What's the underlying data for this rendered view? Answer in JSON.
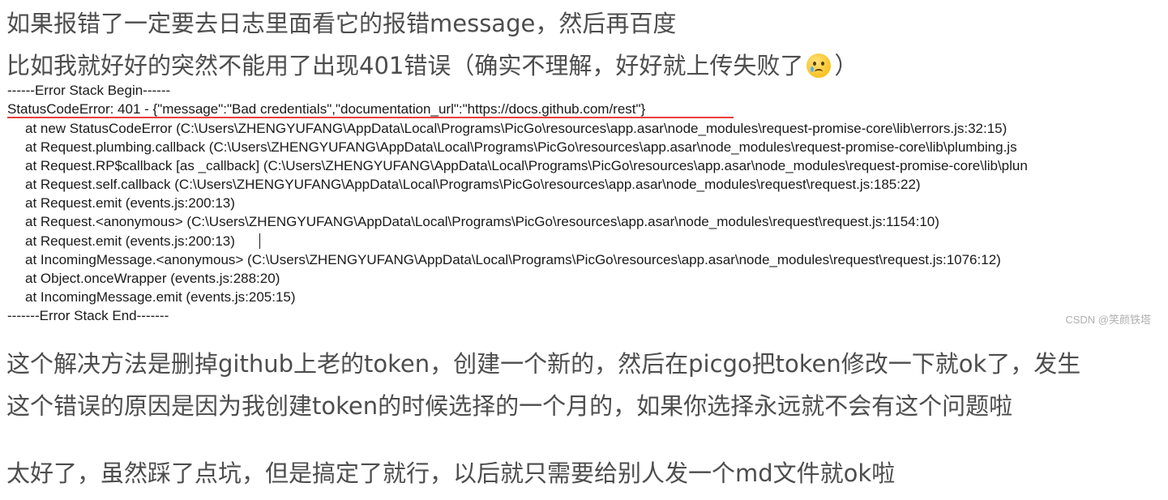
{
  "intro": {
    "line1": "如果报错了一定要去日志里面看它的报错message，然后再百度",
    "line2_text": "比如我就好好的突然不能用了出现401错误（确实不理解，好好就上传失败了",
    "line2_close": "）",
    "emoji_icon": "sad-tear-face-emoji"
  },
  "log": {
    "stack_begin": "------Error Stack Begin------",
    "error_line": "StatusCodeError: 401 - {\"message\":\"Bad credentials\",\"documentation_url\":\"https://docs.github.com/rest\"}",
    "frames": [
      "at new StatusCodeError (C:\\Users\\ZHENGYUFANG\\AppData\\Local\\Programs\\PicGo\\resources\\app.asar\\node_modules\\request-promise-core\\lib\\errors.js:32:15)",
      "at Request.plumbing.callback (C:\\Users\\ZHENGYUFANG\\AppData\\Local\\Programs\\PicGo\\resources\\app.asar\\node_modules\\request-promise-core\\lib\\plumbing.js",
      "at Request.RP$callback [as _callback] (C:\\Users\\ZHENGYUFANG\\AppData\\Local\\Programs\\PicGo\\resources\\app.asar\\node_modules\\request-promise-core\\lib\\plun",
      "at Request.self.callback (C:\\Users\\ZHENGYUFANG\\AppData\\Local\\Programs\\PicGo\\resources\\app.asar\\node_modules\\request\\request.js:185:22)",
      "at Request.emit (events.js:200:13)",
      "at Request.<anonymous> (C:\\Users\\ZHENGYUFANG\\AppData\\Local\\Programs\\PicGo\\resources\\app.asar\\node_modules\\request\\request.js:1154:10)",
      "at Request.emit (events.js:200:13)",
      "at IncomingMessage.<anonymous> (C:\\Users\\ZHENGYUFANG\\AppData\\Local\\Programs\\PicGo\\resources\\app.asar\\node_modules\\request\\request.js:1076:12)",
      "at Object.onceWrapper (events.js:288:20)",
      "at IncomingMessage.emit (events.js:205:15)"
    ],
    "stack_end": "-------Error Stack End-------",
    "watermark": "CSDN @笑颜铁塔",
    "underline_color": "#e8403a"
  },
  "solution": {
    "line1": "这个解决方法是删掉github上老的token，创建一个新的，然后在picgo把token修改一下就ok了，发生",
    "line2": "这个错误的原因是因为我创建token的时候选择的一个月的，如果你选择永远就不会有这个问题啦"
  },
  "closing": {
    "line1": "太好了，虽然踩了点坑，但是搞定了就行，以后就只需要给别人发一个md文件就ok啦"
  }
}
